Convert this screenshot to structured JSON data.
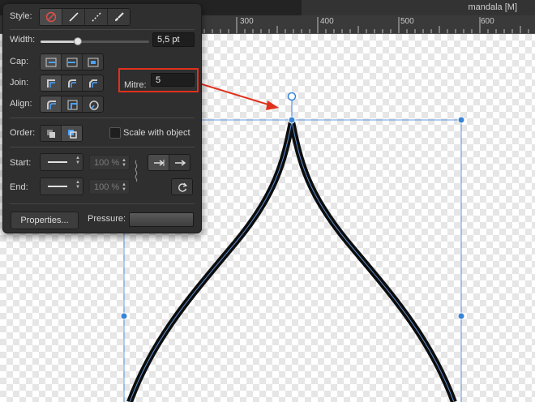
{
  "document": {
    "title": "mandala [M]"
  },
  "ruler": {
    "labels": [
      "300",
      "400",
      "500",
      "600"
    ]
  },
  "panel": {
    "style_label": "Style:",
    "style_buttons": [
      "no-stroke-icon",
      "solid-line-icon",
      "dashed-line-icon",
      "brush-icon"
    ],
    "width_label": "Width:",
    "width_value": "5,5 pt",
    "width_fraction": 0.34,
    "cap_label": "Cap:",
    "join_label": "Join:",
    "align_label": "Align:",
    "mitre_label": "Mitre:",
    "mitre_value": "5",
    "order_label": "Order:",
    "scale_with_object_label": "Scale with object",
    "start_label": "Start:",
    "start_size": "100 %",
    "end_label": "End:",
    "end_size": "100 %",
    "properties_button": "Properties...",
    "pressure_label": "Pressure:"
  },
  "colors": {
    "callout": "#e0311c",
    "selection": "#3a84d8",
    "stroke": "#111111",
    "stroke_inner": "#5a8fd0"
  }
}
